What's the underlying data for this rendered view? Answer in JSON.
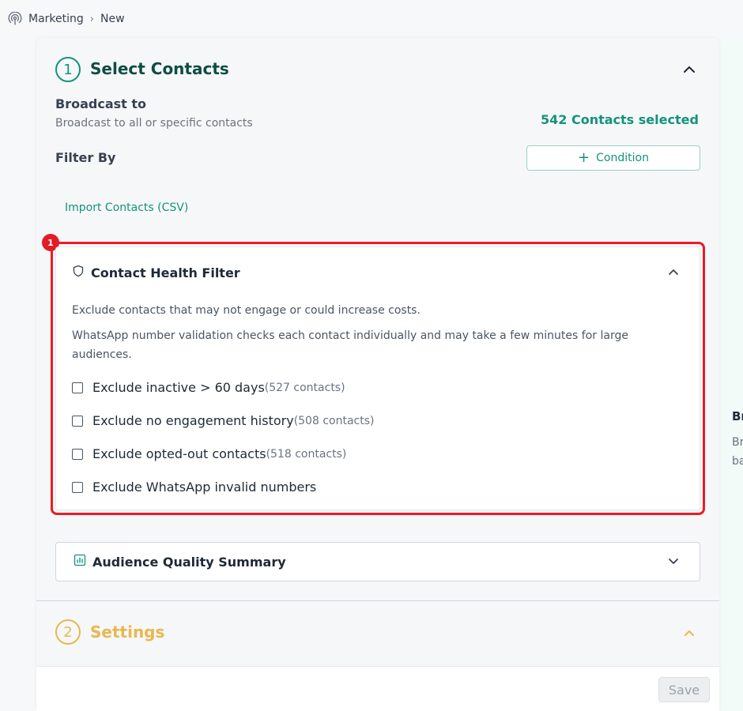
{
  "breadcrumb": {
    "items": [
      "Marketing",
      "New"
    ]
  },
  "step1": {
    "number": "1",
    "title": "Select Contacts",
    "broadcast_to": {
      "label": "Broadcast to",
      "sublabel": "Broadcast to all or specific contacts",
      "selected_count": "542 Contacts selected"
    },
    "filter_by": {
      "label": "Filter By",
      "condition_button": "Condition"
    },
    "import_link": "Import Contacts (CSV)",
    "highlight_badge": "1",
    "contact_health": {
      "title": "Contact Health Filter",
      "desc1": "Exclude contacts that may not engage or could increase costs.",
      "desc2": "WhatsApp number validation checks each contact individually and may take a few minutes for large audiences.",
      "options": [
        {
          "label": "Exclude inactive > 60 days",
          "count": "(527 contacts)",
          "checked": false
        },
        {
          "label": "Exclude no engagement history",
          "count": "(508 contacts)",
          "checked": false
        },
        {
          "label": "Exclude opted-out contacts",
          "count": "(518 contacts)",
          "checked": false
        },
        {
          "label": "Exclude WhatsApp invalid numbers",
          "count": "",
          "checked": false
        }
      ]
    },
    "audience_quality": {
      "title": "Audience Quality Summary"
    }
  },
  "step2": {
    "number": "2",
    "title": "Settings"
  },
  "footer": {
    "save_label": "Save"
  },
  "right_panel": {
    "title": "Br",
    "lines": [
      "Br",
      "ba"
    ]
  },
  "colors": {
    "primary": "#14937a",
    "settings": "#e8b84f",
    "highlight": "#ec1c24"
  }
}
